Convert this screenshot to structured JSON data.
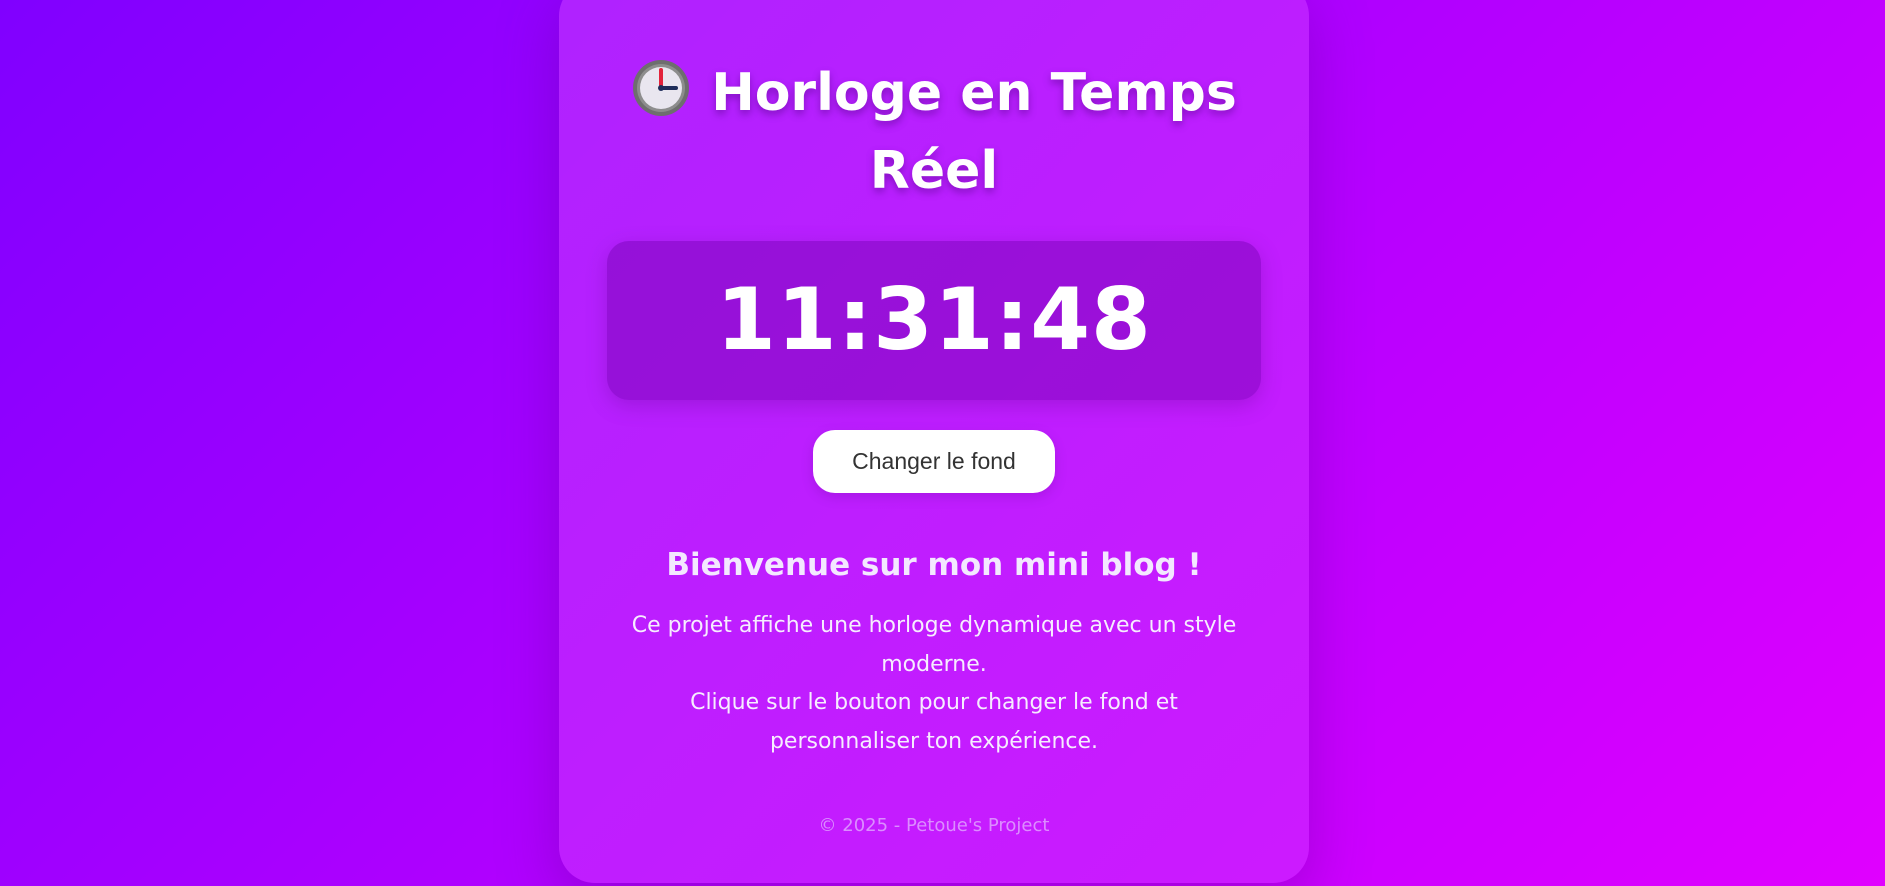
{
  "app": {
    "title": "Horloge en Temps Réel",
    "clock_icon": "clock-icon"
  },
  "clock": {
    "time": "11:31:48"
  },
  "actions": {
    "change_background_label": "Changer le fond"
  },
  "blog": {
    "heading": "Bienvenue sur mon mini blog !",
    "paragraphs": [
      "Ce projet affiche une horloge dynamique avec un style moderne.",
      "Clique sur le bouton pour changer le fond et personnaliser ton expérience."
    ]
  },
  "footer": {
    "text": "© 2025 - Petoue's Project"
  },
  "colors": {
    "background_start": "#8000ff",
    "background_end": "#e000ff",
    "button_background": "#ffffff",
    "button_text": "#333333",
    "text": "#ffffff"
  }
}
